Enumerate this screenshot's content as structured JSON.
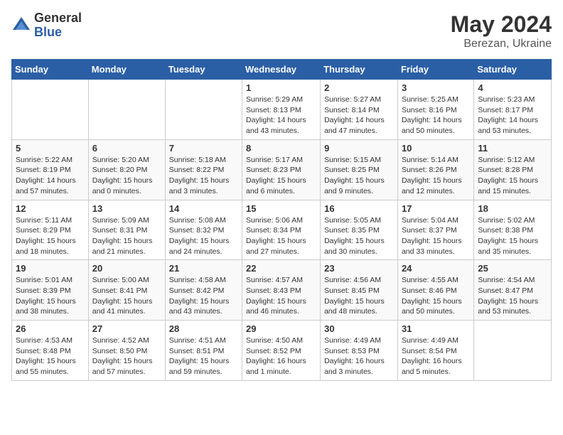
{
  "logo": {
    "general": "General",
    "blue": "Blue"
  },
  "title": {
    "month_year": "May 2024",
    "location": "Berezan, Ukraine"
  },
  "weekdays": [
    "Sunday",
    "Monday",
    "Tuesday",
    "Wednesday",
    "Thursday",
    "Friday",
    "Saturday"
  ],
  "weeks": [
    [
      {
        "day": "",
        "info": ""
      },
      {
        "day": "",
        "info": ""
      },
      {
        "day": "",
        "info": ""
      },
      {
        "day": "1",
        "info": "Sunrise: 5:29 AM\nSunset: 8:13 PM\nDaylight: 14 hours\nand 43 minutes."
      },
      {
        "day": "2",
        "info": "Sunrise: 5:27 AM\nSunset: 8:14 PM\nDaylight: 14 hours\nand 47 minutes."
      },
      {
        "day": "3",
        "info": "Sunrise: 5:25 AM\nSunset: 8:16 PM\nDaylight: 14 hours\nand 50 minutes."
      },
      {
        "day": "4",
        "info": "Sunrise: 5:23 AM\nSunset: 8:17 PM\nDaylight: 14 hours\nand 53 minutes."
      }
    ],
    [
      {
        "day": "5",
        "info": "Sunrise: 5:22 AM\nSunset: 8:19 PM\nDaylight: 14 hours\nand 57 minutes."
      },
      {
        "day": "6",
        "info": "Sunrise: 5:20 AM\nSunset: 8:20 PM\nDaylight: 15 hours\nand 0 minutes."
      },
      {
        "day": "7",
        "info": "Sunrise: 5:18 AM\nSunset: 8:22 PM\nDaylight: 15 hours\nand 3 minutes."
      },
      {
        "day": "8",
        "info": "Sunrise: 5:17 AM\nSunset: 8:23 PM\nDaylight: 15 hours\nand 6 minutes."
      },
      {
        "day": "9",
        "info": "Sunrise: 5:15 AM\nSunset: 8:25 PM\nDaylight: 15 hours\nand 9 minutes."
      },
      {
        "day": "10",
        "info": "Sunrise: 5:14 AM\nSunset: 8:26 PM\nDaylight: 15 hours\nand 12 minutes."
      },
      {
        "day": "11",
        "info": "Sunrise: 5:12 AM\nSunset: 8:28 PM\nDaylight: 15 hours\nand 15 minutes."
      }
    ],
    [
      {
        "day": "12",
        "info": "Sunrise: 5:11 AM\nSunset: 8:29 PM\nDaylight: 15 hours\nand 18 minutes."
      },
      {
        "day": "13",
        "info": "Sunrise: 5:09 AM\nSunset: 8:31 PM\nDaylight: 15 hours\nand 21 minutes."
      },
      {
        "day": "14",
        "info": "Sunrise: 5:08 AM\nSunset: 8:32 PM\nDaylight: 15 hours\nand 24 minutes."
      },
      {
        "day": "15",
        "info": "Sunrise: 5:06 AM\nSunset: 8:34 PM\nDaylight: 15 hours\nand 27 minutes."
      },
      {
        "day": "16",
        "info": "Sunrise: 5:05 AM\nSunset: 8:35 PM\nDaylight: 15 hours\nand 30 minutes."
      },
      {
        "day": "17",
        "info": "Sunrise: 5:04 AM\nSunset: 8:37 PM\nDaylight: 15 hours\nand 33 minutes."
      },
      {
        "day": "18",
        "info": "Sunrise: 5:02 AM\nSunset: 8:38 PM\nDaylight: 15 hours\nand 35 minutes."
      }
    ],
    [
      {
        "day": "19",
        "info": "Sunrise: 5:01 AM\nSunset: 8:39 PM\nDaylight: 15 hours\nand 38 minutes."
      },
      {
        "day": "20",
        "info": "Sunrise: 5:00 AM\nSunset: 8:41 PM\nDaylight: 15 hours\nand 41 minutes."
      },
      {
        "day": "21",
        "info": "Sunrise: 4:58 AM\nSunset: 8:42 PM\nDaylight: 15 hours\nand 43 minutes."
      },
      {
        "day": "22",
        "info": "Sunrise: 4:57 AM\nSunset: 8:43 PM\nDaylight: 15 hours\nand 46 minutes."
      },
      {
        "day": "23",
        "info": "Sunrise: 4:56 AM\nSunset: 8:45 PM\nDaylight: 15 hours\nand 48 minutes."
      },
      {
        "day": "24",
        "info": "Sunrise: 4:55 AM\nSunset: 8:46 PM\nDaylight: 15 hours\nand 50 minutes."
      },
      {
        "day": "25",
        "info": "Sunrise: 4:54 AM\nSunset: 8:47 PM\nDaylight: 15 hours\nand 53 minutes."
      }
    ],
    [
      {
        "day": "26",
        "info": "Sunrise: 4:53 AM\nSunset: 8:48 PM\nDaylight: 15 hours\nand 55 minutes."
      },
      {
        "day": "27",
        "info": "Sunrise: 4:52 AM\nSunset: 8:50 PM\nDaylight: 15 hours\nand 57 minutes."
      },
      {
        "day": "28",
        "info": "Sunrise: 4:51 AM\nSunset: 8:51 PM\nDaylight: 15 hours\nand 59 minutes."
      },
      {
        "day": "29",
        "info": "Sunrise: 4:50 AM\nSunset: 8:52 PM\nDaylight: 16 hours\nand 1 minute."
      },
      {
        "day": "30",
        "info": "Sunrise: 4:49 AM\nSunset: 8:53 PM\nDaylight: 16 hours\nand 3 minutes."
      },
      {
        "day": "31",
        "info": "Sunrise: 4:49 AM\nSunset: 8:54 PM\nDaylight: 16 hours\nand 5 minutes."
      },
      {
        "day": "",
        "info": ""
      }
    ]
  ]
}
